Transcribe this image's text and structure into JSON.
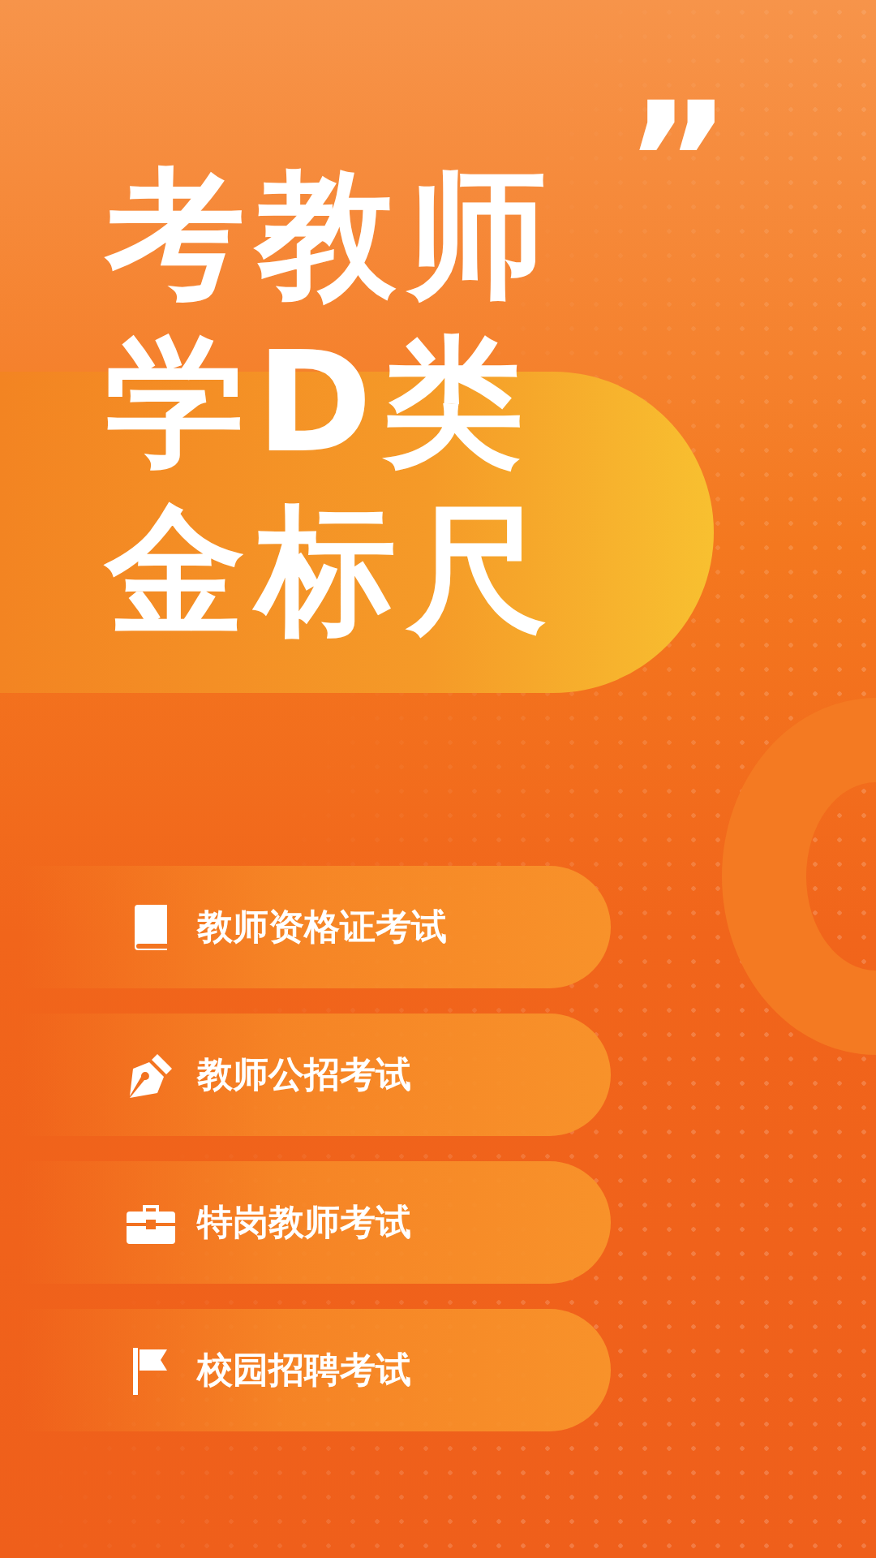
{
  "headline": {
    "quote_mark": "”",
    "lines": [
      "考教师",
      "学D类",
      "金标尺"
    ]
  },
  "menu": [
    {
      "kind": "book",
      "label": "教师资格证考试"
    },
    {
      "kind": "pen",
      "label": "教师公招考试"
    },
    {
      "kind": "briefcase",
      "label": "特岗教师考试"
    },
    {
      "kind": "flag",
      "label": "校园招聘考试"
    }
  ]
}
